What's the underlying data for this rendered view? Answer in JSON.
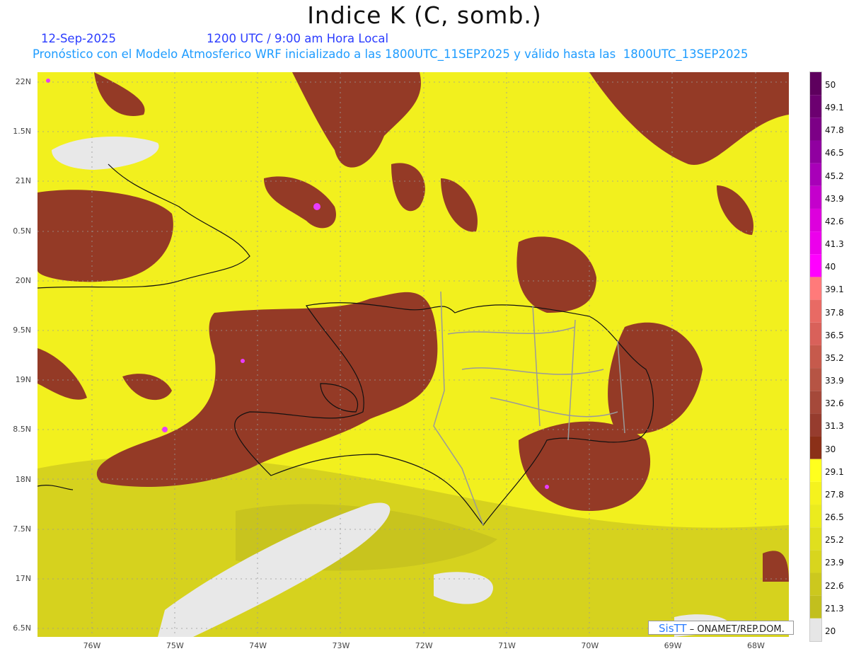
{
  "title": "Indice K (C, somb.)",
  "date": "12-Sep-2025",
  "time": "1200 UTC / 9:00 am Hora Local",
  "description": "Pronóstico con el Modelo Atmosferico WRF inicializado a las 1800UTC_11SEP2025 y válido hasta las  1800UTC_13SEP2025",
  "lat_labels": [
    "22N",
    "1.5N",
    "21N",
    "0.5N",
    "20N",
    "9.5N",
    "19N",
    "8.5N",
    "18N",
    "7.5N",
    "17N",
    "6.5N"
  ],
  "lon_labels": [
    "76W",
    "75W",
    "74W",
    "73W",
    "72W",
    "71W",
    "70W",
    "69W",
    "68W"
  ],
  "colorbar": {
    "labels": [
      "50",
      "49.1",
      "47.8",
      "46.5",
      "45.2",
      "43.9",
      "42.6",
      "41.3",
      "40",
      "39.1",
      "37.8",
      "36.5",
      "35.2",
      "33.9",
      "32.6",
      "31.3",
      "30",
      "29.1",
      "27.8",
      "26.5",
      "25.2",
      "23.9",
      "22.6",
      "21.3",
      "20"
    ],
    "colors": [
      "#5e005e",
      "#6c0070",
      "#7c0086",
      "#9000a0",
      "#a800b8",
      "#c400cc",
      "#dd00dd",
      "#ec00ec",
      "#ff00ff",
      "#ff7a7a",
      "#e86a64",
      "#d9615a",
      "#c65a4c",
      "#b65444",
      "#a5493a",
      "#963c2e",
      "#8b3018",
      "#ffff1e",
      "#f5f21e",
      "#ebeb1e",
      "#e0df1e",
      "#d8d51e",
      "#ccc81e",
      "#c2bf1e",
      "#e6e6e6"
    ]
  },
  "credit": {
    "brand": "SisTT",
    "text": " – ONAMET/REP.DOM."
  }
}
